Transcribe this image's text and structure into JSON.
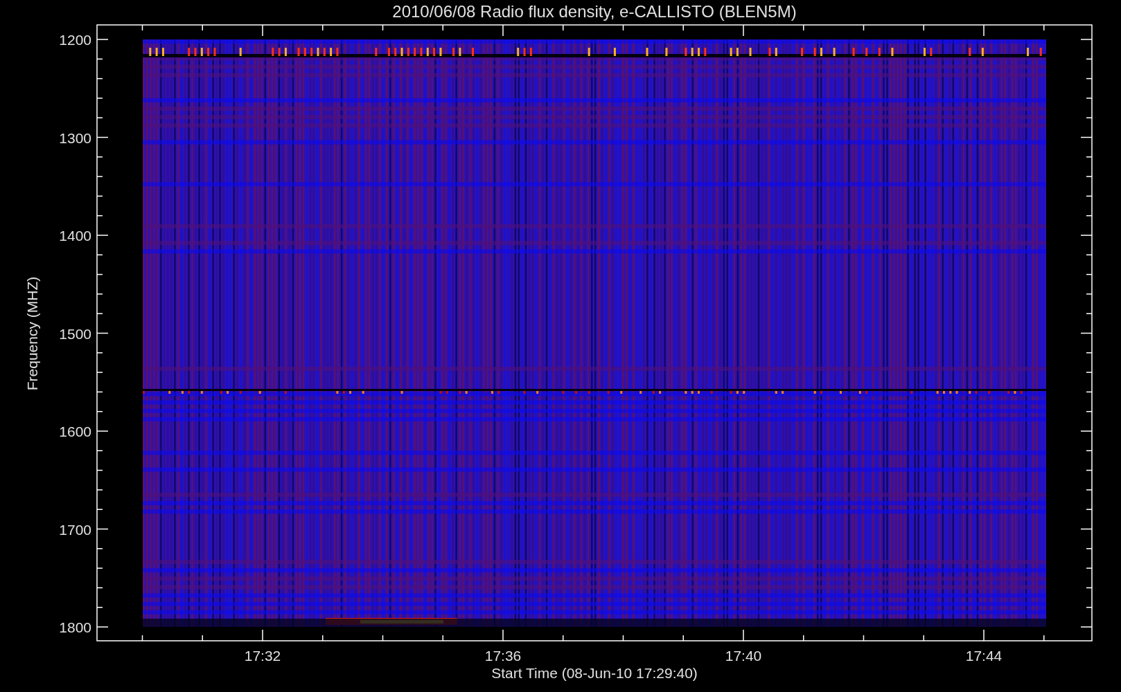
{
  "title": "2010/06/08  Radio flux density, e-CALLISTO (BLEN5M)",
  "y_axis": {
    "label": "Frequency (MHZ)",
    "ticks": [
      "1200",
      "1300",
      "1400",
      "1500",
      "1600",
      "1700",
      "1800"
    ]
  },
  "x_axis": {
    "label": "Start Time (08-Jun-10 17:29:40)",
    "ticks": [
      "17:32",
      "17:36",
      "17:40",
      "17:44"
    ]
  }
}
